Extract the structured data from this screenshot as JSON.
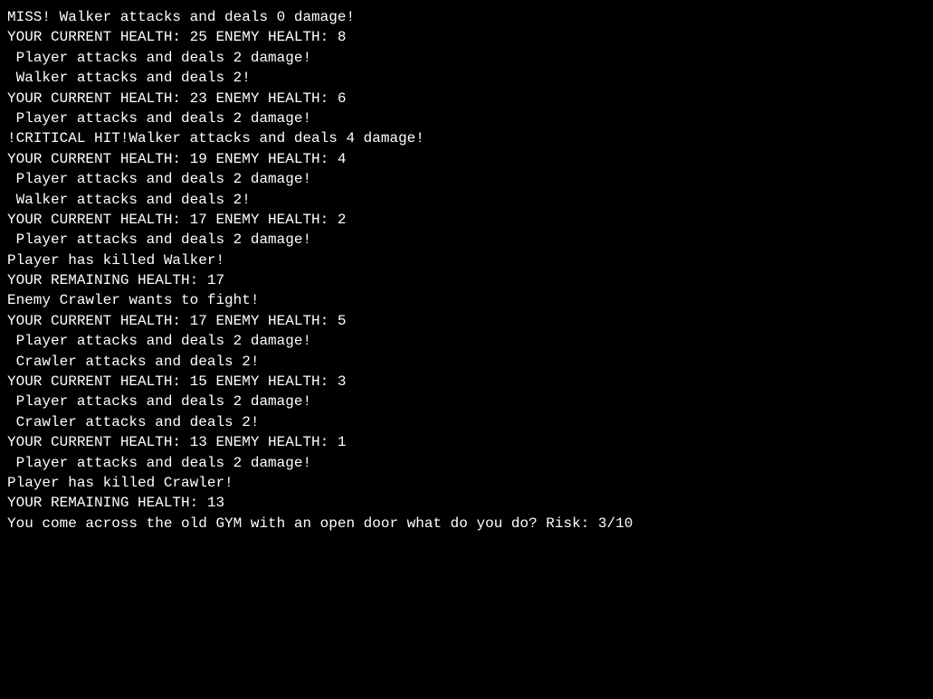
{
  "log": {
    "lines": [
      "MISS! Walker attacks and deals 0 damage!",
      "YOUR CURRENT HEALTH: 25 ENEMY HEALTH: 8",
      " Player attacks and deals 2 damage!",
      " Walker attacks and deals 2!",
      "YOUR CURRENT HEALTH: 23 ENEMY HEALTH: 6",
      " Player attacks and deals 2 damage!",
      "!CRITICAL HIT!Walker attacks and deals 4 damage!",
      "YOUR CURRENT HEALTH: 19 ENEMY HEALTH: 4",
      " Player attacks and deals 2 damage!",
      " Walker attacks and deals 2!",
      "YOUR CURRENT HEALTH: 17 ENEMY HEALTH: 2",
      " Player attacks and deals 2 damage!",
      "Player has killed Walker!",
      "YOUR REMAINING HEALTH: 17",
      "Enemy Crawler wants to fight!",
      "YOUR CURRENT HEALTH: 17 ENEMY HEALTH: 5",
      " Player attacks and deals 2 damage!",
      " Crawler attacks and deals 2!",
      "YOUR CURRENT HEALTH: 15 ENEMY HEALTH: 3",
      " Player attacks and deals 2 damage!",
      " Crawler attacks and deals 2!",
      "YOUR CURRENT HEALTH: 13 ENEMY HEALTH: 1",
      " Player attacks and deals 2 damage!",
      "Player has killed Crawler!",
      "YOUR REMAINING HEALTH: 13",
      "You come across the old GYM with an open door what do you do? Risk: 3/10"
    ]
  }
}
